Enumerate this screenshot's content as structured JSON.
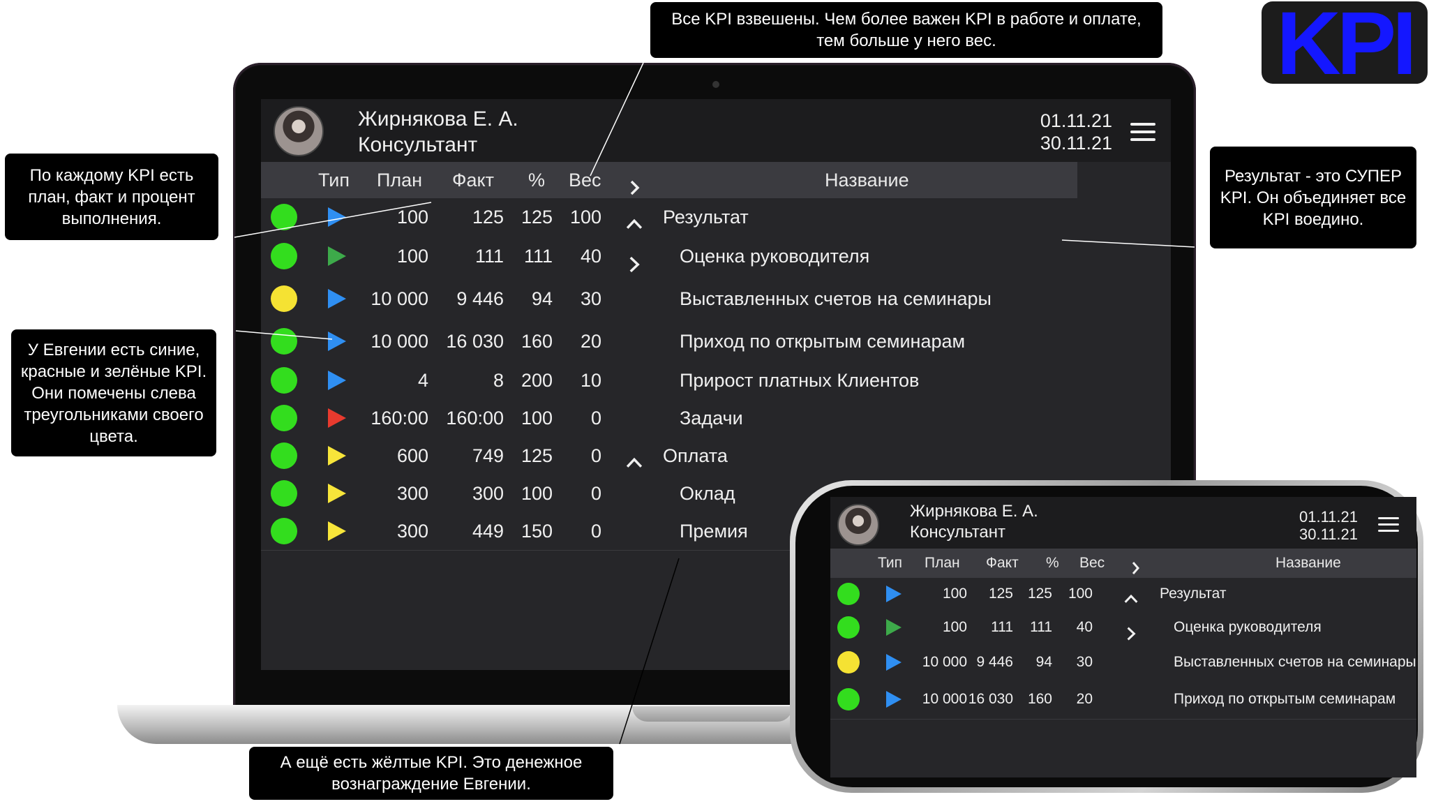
{
  "badge": {
    "text": "KPI",
    "color": "#1417ff"
  },
  "user": {
    "name": "Жирнякова Е. А.",
    "role": "Консультант"
  },
  "period": {
    "from": "01.11.21",
    "to": "30.11.21"
  },
  "columns": {
    "type": "Тип",
    "plan": "План",
    "fact": "Факт",
    "pct": "%",
    "weight": "Вес",
    "title": "Название"
  },
  "colors": {
    "green": "#33dd1e",
    "yellow": "#f5e233",
    "blue": "#2f8ff2",
    "dark_green": "#3daa4a",
    "red": "#e83a2e",
    "yellow_tri": "#f7e53a"
  },
  "rows": [
    {
      "status": "green",
      "tri": "blue",
      "plan": "100",
      "fact": "125",
      "pct": "125",
      "weight": "100",
      "chevron": "up",
      "title": "Результат",
      "indent": false
    },
    {
      "status": "green",
      "tri": "dark_green",
      "plan": "100",
      "fact": "111",
      "pct": "111",
      "weight": "40",
      "chevron": "right",
      "title": "Оценка руководителя",
      "indent": true
    },
    {
      "status": "yellow",
      "tri": "blue",
      "plan": "10 000",
      "fact": "9 446",
      "pct": "94",
      "weight": "30",
      "chevron": "",
      "title": "Выставленных счетов на семинары",
      "indent": true
    },
    {
      "status": "green",
      "tri": "blue",
      "plan": "10 000",
      "fact": "16 030",
      "pct": "160",
      "weight": "20",
      "chevron": "",
      "title": "Приход по открытым семинарам",
      "indent": true
    },
    {
      "status": "green",
      "tri": "blue",
      "plan": "4",
      "fact": "8",
      "pct": "200",
      "weight": "10",
      "chevron": "",
      "title": "Прирост платных Клиентов",
      "indent": true
    },
    {
      "status": "green",
      "tri": "red",
      "plan": "160:00",
      "fact": "160:00",
      "pct": "100",
      "weight": "0",
      "chevron": "",
      "title": "Задачи",
      "indent": true
    },
    {
      "status": "green",
      "tri": "yellow_tri",
      "plan": "600",
      "fact": "749",
      "pct": "125",
      "weight": "0",
      "chevron": "up",
      "title": "Оплата",
      "indent": false
    },
    {
      "status": "green",
      "tri": "yellow_tri",
      "plan": "300",
      "fact": "300",
      "pct": "100",
      "weight": "0",
      "chevron": "",
      "title": "Оклад",
      "indent": true
    },
    {
      "status": "green",
      "tri": "yellow_tri",
      "plan": "300",
      "fact": "449",
      "pct": "150",
      "weight": "0",
      "chevron": "",
      "title": "Премия",
      "indent": true
    }
  ],
  "phone_rows": [
    {
      "status": "green",
      "tri": "blue",
      "plan": "100",
      "fact": "125",
      "pct": "125",
      "weight": "100",
      "chevron": "up",
      "title": "Результат",
      "indent": false
    },
    {
      "status": "green",
      "tri": "dark_green",
      "plan": "100",
      "fact": "111",
      "pct": "111",
      "weight": "40",
      "chevron": "right",
      "title": "Оценка руководителя",
      "indent": true
    },
    {
      "status": "yellow",
      "tri": "blue",
      "plan": "10 000",
      "fact": "9 446",
      "pct": "94",
      "weight": "30",
      "chevron": "",
      "title": "Выставленных счетов на семинары",
      "indent": true
    },
    {
      "status": "green",
      "tri": "blue",
      "plan": "10 000",
      "fact": "16 030",
      "pct": "160",
      "weight": "20",
      "chevron": "",
      "title": "Приход по открытым семинарам",
      "indent": true
    }
  ],
  "callouts": {
    "weights": "Все KPI взвешены. Чем более важен KPI в работе и оплате, тем больше у него вес.",
    "plan_fact": "По каждому KPI есть план, факт и процент выполнения.",
    "colors": "У Евгении есть синие, красные и зелёные KPI. Они помечены слева треугольниками своего цвета.",
    "result": "Результат - это СУПЕР KPI. Он объединяет все KPI воедино.",
    "yellow": "А ещё есть жёлтые KPI. Это денежное вознаграждение Евгении."
  }
}
